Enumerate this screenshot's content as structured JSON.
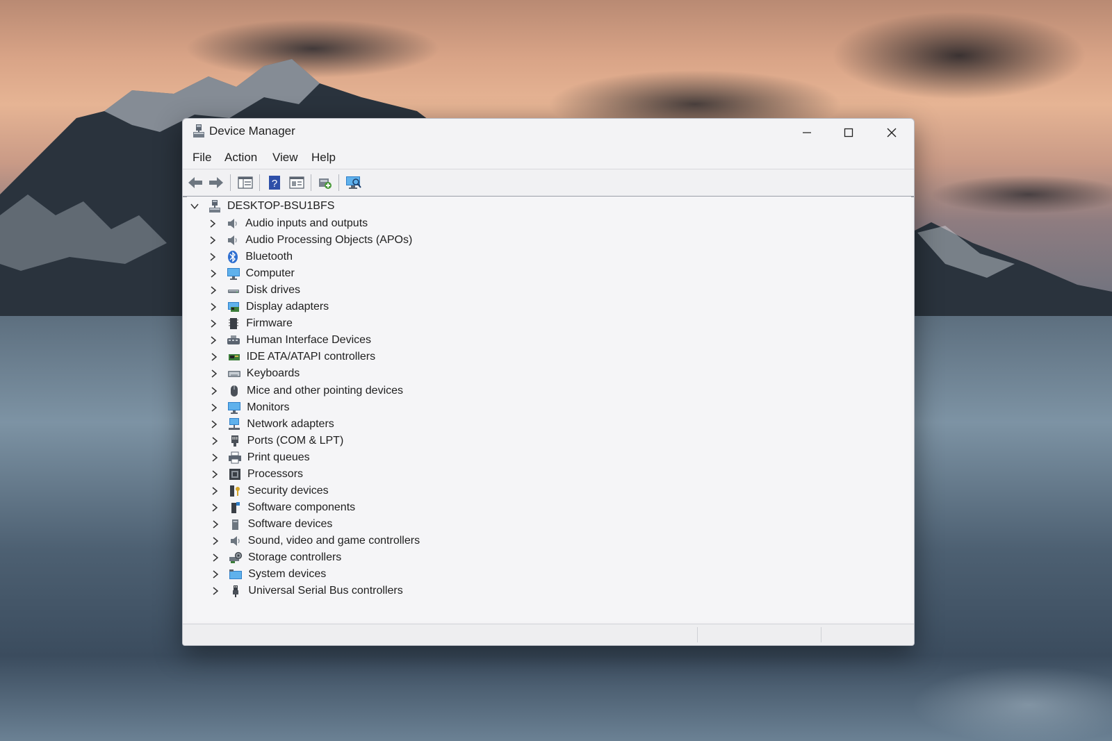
{
  "window": {
    "title": "Device Manager",
    "controls": [
      "minimize-icon",
      "maximize-icon",
      "close-icon"
    ]
  },
  "menu": {
    "items": [
      "File",
      "Action",
      "View",
      "Help"
    ]
  },
  "toolbar": {
    "buttons": [
      "back-icon",
      "forward-icon",
      "show-hide-console-tree-icon",
      "help-icon",
      "properties-icon",
      "update-driver-icon",
      "scan-hardware-icon"
    ]
  },
  "tree": {
    "root": {
      "label": "DESKTOP-BSU1BFS",
      "expanded": true,
      "icon": "computer-icon"
    },
    "categories": [
      {
        "label": "Audio inputs and outputs",
        "icon": "speaker-icon"
      },
      {
        "label": "Audio Processing Objects (APOs)",
        "icon": "speaker-icon"
      },
      {
        "label": "Bluetooth",
        "icon": "bluetooth-icon"
      },
      {
        "label": "Computer",
        "icon": "monitor-icon"
      },
      {
        "label": "Disk drives",
        "icon": "disk-drive-icon"
      },
      {
        "label": "Display adapters",
        "icon": "display-adapter-icon"
      },
      {
        "label": "Firmware",
        "icon": "firmware-icon"
      },
      {
        "label": "Human Interface Devices",
        "icon": "hid-icon"
      },
      {
        "label": "IDE ATA/ATAPI controllers",
        "icon": "ide-controller-icon"
      },
      {
        "label": "Keyboards",
        "icon": "keyboard-icon"
      },
      {
        "label": "Mice and other pointing devices",
        "icon": "mouse-icon"
      },
      {
        "label": "Monitors",
        "icon": "monitor-icon"
      },
      {
        "label": "Network adapters",
        "icon": "network-icon"
      },
      {
        "label": "Ports (COM & LPT)",
        "icon": "port-icon"
      },
      {
        "label": "Print queues",
        "icon": "printer-icon"
      },
      {
        "label": "Processors",
        "icon": "processor-icon"
      },
      {
        "label": "Security devices",
        "icon": "security-icon"
      },
      {
        "label": "Software components",
        "icon": "software-component-icon"
      },
      {
        "label": "Software devices",
        "icon": "software-device-icon"
      },
      {
        "label": "Sound, video and game controllers",
        "icon": "speaker-icon"
      },
      {
        "label": "Storage controllers",
        "icon": "storage-icon"
      },
      {
        "label": "System devices",
        "icon": "system-icon"
      },
      {
        "label": "Universal Serial Bus controllers",
        "icon": "usb-icon"
      }
    ]
  }
}
